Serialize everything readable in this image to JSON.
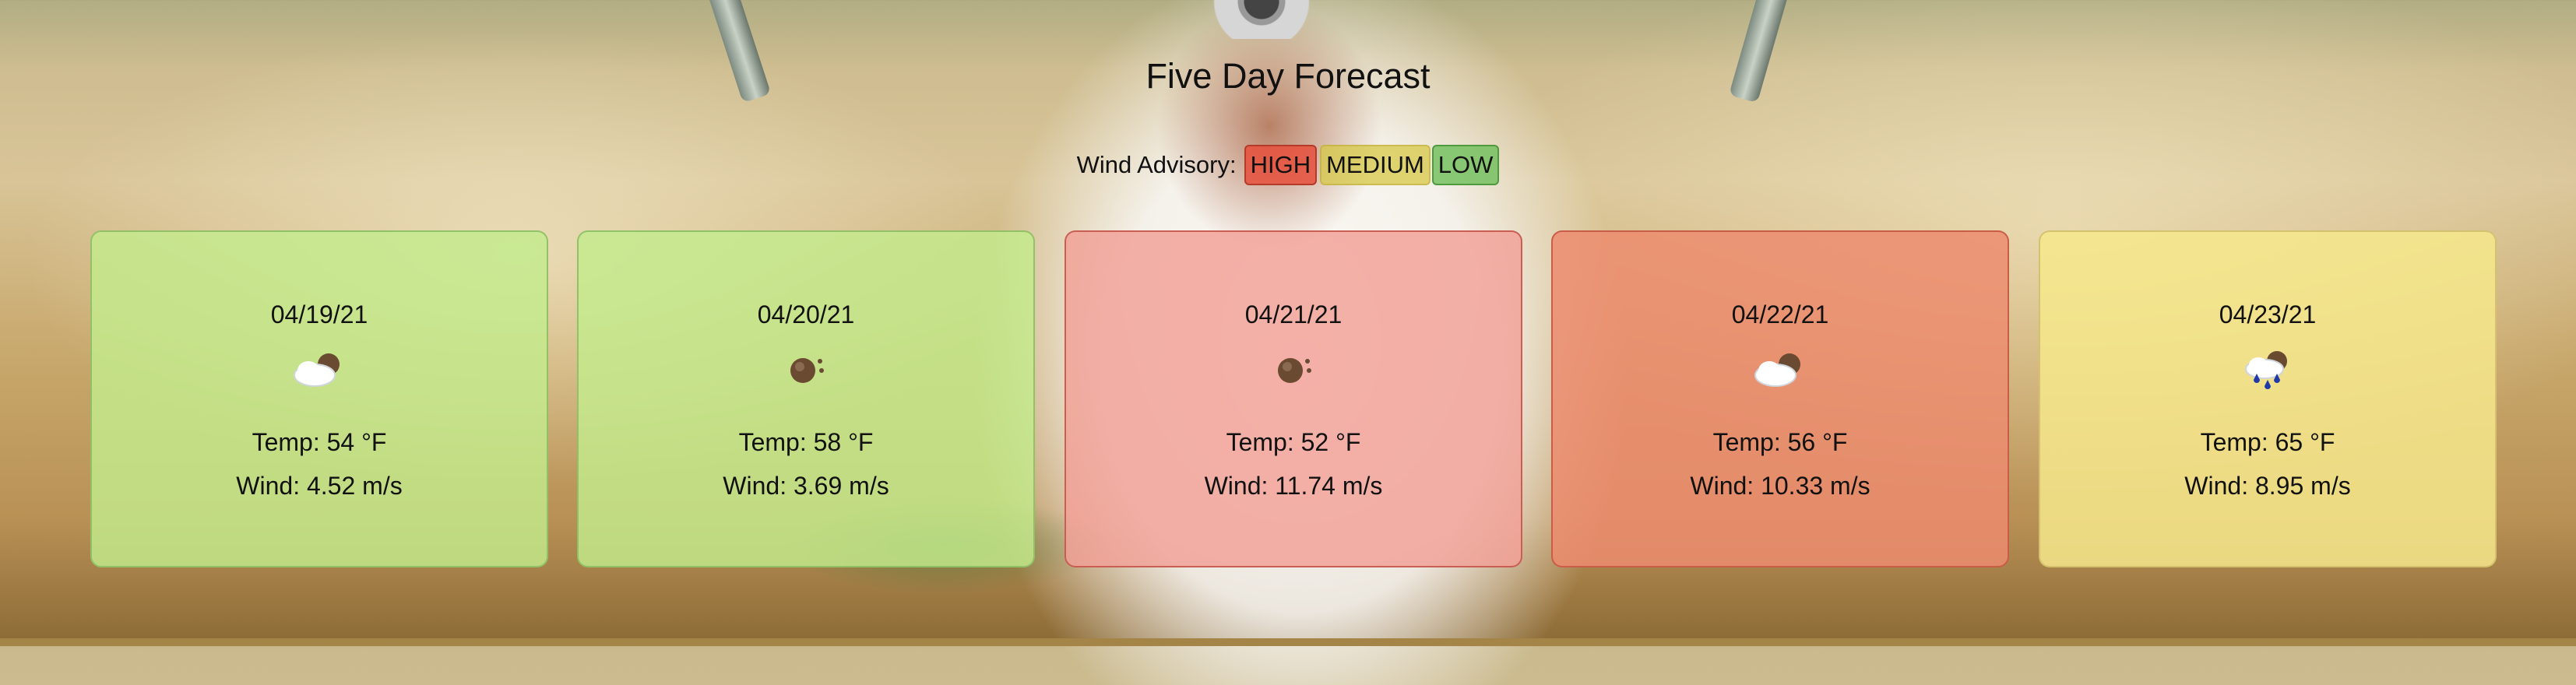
{
  "header": {
    "title": "Five Day Forecast"
  },
  "advisory": {
    "label": "Wind Advisory:",
    "levels": [
      {
        "label": "HIGH",
        "color": "#e6503c"
      },
      {
        "label": "MEDIUM",
        "color": "#d6c846"
      },
      {
        "label": "LOW",
        "color": "#6ebe5a"
      }
    ]
  },
  "forecast": [
    {
      "date": "04/19/21",
      "icon": "partly-cloudy-icon",
      "temp": "Temp: 54 °F",
      "wind": "Wind: 4.52 m/s",
      "level": "LOW",
      "color": "#c3eb8c"
    },
    {
      "date": "04/20/21",
      "icon": "clear-sky-icon",
      "temp": "Temp: 58 °F",
      "wind": "Wind: 3.69 m/s",
      "level": "LOW",
      "color": "#c3eb8c"
    },
    {
      "date": "04/21/21",
      "icon": "clear-sky-icon",
      "temp": "Temp: 52 °F",
      "wind": "Wind: 11.74 m/s",
      "level": "HIGH",
      "color": "#f2a096"
    },
    {
      "date": "04/22/21",
      "icon": "partly-cloudy-icon",
      "temp": "Temp: 56 °F",
      "wind": "Wind: 10.33 m/s",
      "level": "HIGH",
      "color": "#ec8c6e"
    },
    {
      "date": "04/23/21",
      "icon": "rain-icon",
      "temp": "Temp: 65 °F",
      "wind": "Wind: 8.95 m/s",
      "level": "MEDIUM",
      "color": "#f6e88c"
    }
  ]
}
